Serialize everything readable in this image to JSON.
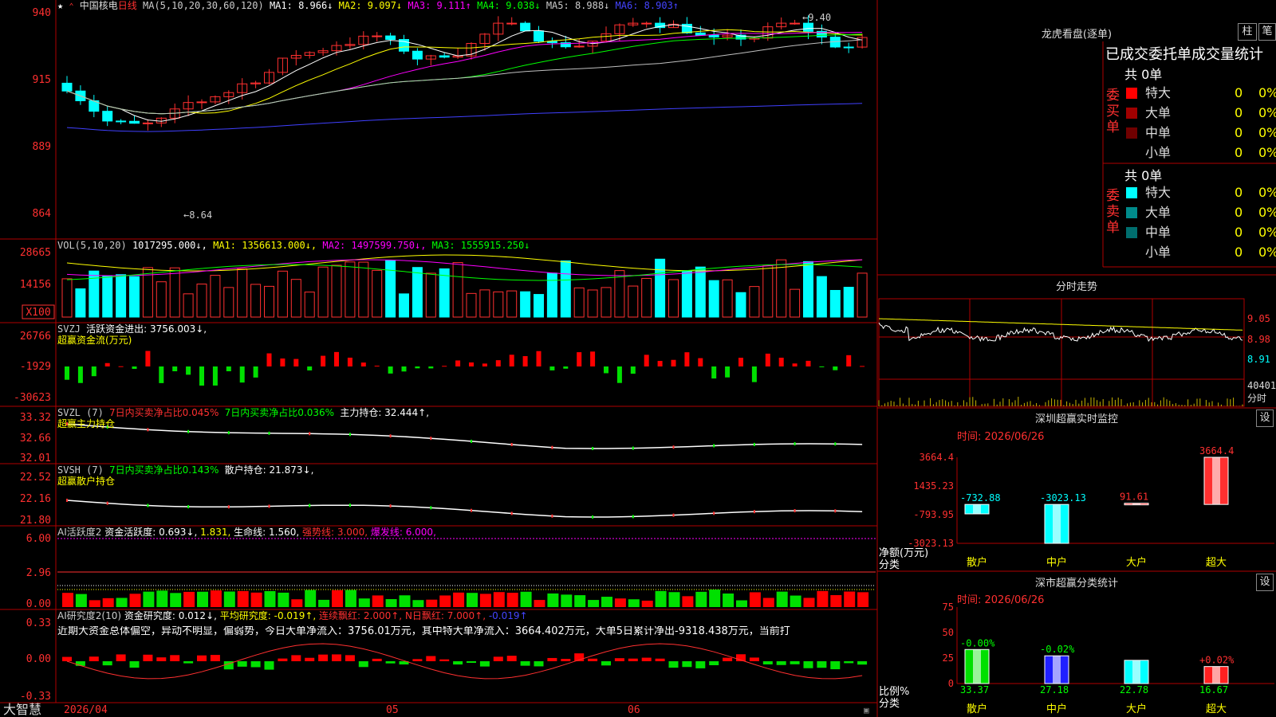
{
  "stock": {
    "name": "中国核电",
    "period": "日线",
    "star": "★",
    "mark": "⌃"
  },
  "ma_header": {
    "params": "MA(5,10,20,30,60,120)",
    "ma1": "MA1: 8.966↓",
    "ma2": "MA2: 9.097↓",
    "ma3": "MA3: 9.111↑",
    "ma4": "MA4: 9.038↓",
    "ma5": "MA5: 8.988↓",
    "ma6": "MA6: 8.903↑"
  },
  "price_axis": [
    "940",
    "915",
    "889",
    "864"
  ],
  "price_annotations": {
    "high": "9.40",
    "low": "8.64"
  },
  "vol_header": {
    "params": "VOL(5,10,20)",
    "vol": "1017295.000↓,",
    "ma1": "MA1: 1356613.000↓,",
    "ma2": "MA2: 1497599.750↓,",
    "ma3": "MA3: 1555915.250↓"
  },
  "vol_axis": [
    "28665",
    "14156"
  ],
  "vol_unit": "X100",
  "svzj": {
    "label": "SVZJ",
    "text": "活跃资金进出: 3756.003↓,",
    "sub": "超赢资金流(万元)",
    "axis": [
      "26766",
      "-1929",
      "-30623"
    ]
  },
  "svzl": {
    "label": "SVZL (7)",
    "t1": "7日内买卖净占比0.045%",
    "t2": "7日内买卖净占比0.036%",
    "t3": "主力持仓: 32.444↑,",
    "sub": "超赢主力持仓",
    "axis": [
      "33.32",
      "32.66",
      "32.01"
    ]
  },
  "svsh": {
    "label": "SVSH (7)",
    "t1": "7日内买卖净占比0.143%",
    "t2": "散户持仓: 21.873↓,",
    "sub": "超赢散户持仓",
    "axis": [
      "22.52",
      "22.16",
      "21.80"
    ]
  },
  "ai1": {
    "label": "AI活跃度2",
    "t1": "资金活跃度: 0.693↓,",
    "t2": "1.831,",
    "t3": "生命线: 1.560,",
    "t4": "强势线: 3.000,",
    "t5": "爆发线: 6.000,",
    "axis": [
      "6.00",
      "2.96",
      "0.00"
    ]
  },
  "ai2": {
    "label": "AI研究度2(10)",
    "t1": "资金研究度: 0.012↓,",
    "t2": "平均研究度: -0.019↑,",
    "t3": "连续飘红: 2.000↑,",
    "t4": "N日飘红: 7.000↑,",
    "t5": "-0.019↑",
    "desc": "近期大资金总体偏空，异动不明显，偏弱势，今日大单净流入：3756.01万元，其中特大单净流入：3664.402万元，大单5日累计净出-9318.438万元，当前打",
    "axis": [
      "0.33",
      "0.00",
      "-0.33"
    ]
  },
  "bottom_bar": {
    "brand": "大智慧",
    "dates": [
      "2026/04",
      "05",
      "06"
    ]
  },
  "longhu": {
    "title": "龙虎看盘(逐单)",
    "btn_zhu": "柱",
    "btn_bi": "笔",
    "subtitle": "已成交委托单成交量统计",
    "buy_label": "委买单",
    "sell_label": "委卖单",
    "buy_total": "共 0单",
    "sell_total": "共 0单",
    "buy_rows": [
      {
        "name": "特大",
        "v": "0",
        "p": "0%",
        "color": "#ff0000"
      },
      {
        "name": "大单",
        "v": "0",
        "p": "0%",
        "color": "#a00000"
      },
      {
        "name": "中单",
        "v": "0",
        "p": "0%",
        "color": "#700000"
      },
      {
        "name": "小单",
        "v": "0",
        "p": "0%",
        "color": ""
      }
    ],
    "sell_rows": [
      {
        "name": "特大",
        "v": "0",
        "p": "0%",
        "color": "#00ffff"
      },
      {
        "name": "大单",
        "v": "0",
        "p": "0%",
        "color": "#008b8b"
      },
      {
        "name": "中单",
        "v": "0",
        "p": "0%",
        "color": "#006e6e"
      },
      {
        "name": "小单",
        "v": "0",
        "p": "0%",
        "color": ""
      }
    ]
  },
  "fenshi": {
    "title": "分时走势",
    "axis": [
      "9.05",
      "8.98",
      "8.91"
    ],
    "vol_val": "40401",
    "vol_label": "分时"
  },
  "sz_monitor": {
    "title": "深圳超赢实时监控",
    "btn": "设",
    "time": "时间: 2026/06/26",
    "axis": [
      "3664.4",
      "1435.23",
      "-793.95",
      "-3023.13"
    ],
    "net_label": "净额(万元)",
    "cat_label": "分类",
    "chart_data": {
      "type": "bar",
      "categories": [
        "散户",
        "中户",
        "大户",
        "超大"
      ],
      "values": [
        -732.88,
        -3023.13,
        91.61,
        3664.4
      ],
      "ylim": [
        -3023.13,
        3664.4
      ]
    }
  },
  "sz_class": {
    "title": "深市超赢分类统计",
    "btn": "设",
    "time": "时间: 2026/06/26",
    "axis": [
      "75",
      "50",
      "25",
      "0"
    ],
    "ratio_label": "比例%",
    "cat_label": "分类",
    "chart_data": {
      "type": "bar",
      "categories": [
        "散户",
        "中户",
        "大户",
        "超大"
      ],
      "values": [
        33.37,
        27.18,
        22.78,
        16.67
      ],
      "changes": [
        "-0.00%",
        "-0.02%",
        "",
        "+0.02%"
      ],
      "ylim": [
        0,
        75
      ]
    }
  },
  "colors": {
    "up": "#ff3030",
    "down": "#00ffff",
    "grid": "#b00000",
    "axis_text": "#ff3030",
    "ma1": "#ffffff",
    "ma2": "#ffff00",
    "ma3": "#ff00ff",
    "ma4": "#00ff00",
    "ma5": "#c0c0c0",
    "ma6": "#4040ff"
  }
}
